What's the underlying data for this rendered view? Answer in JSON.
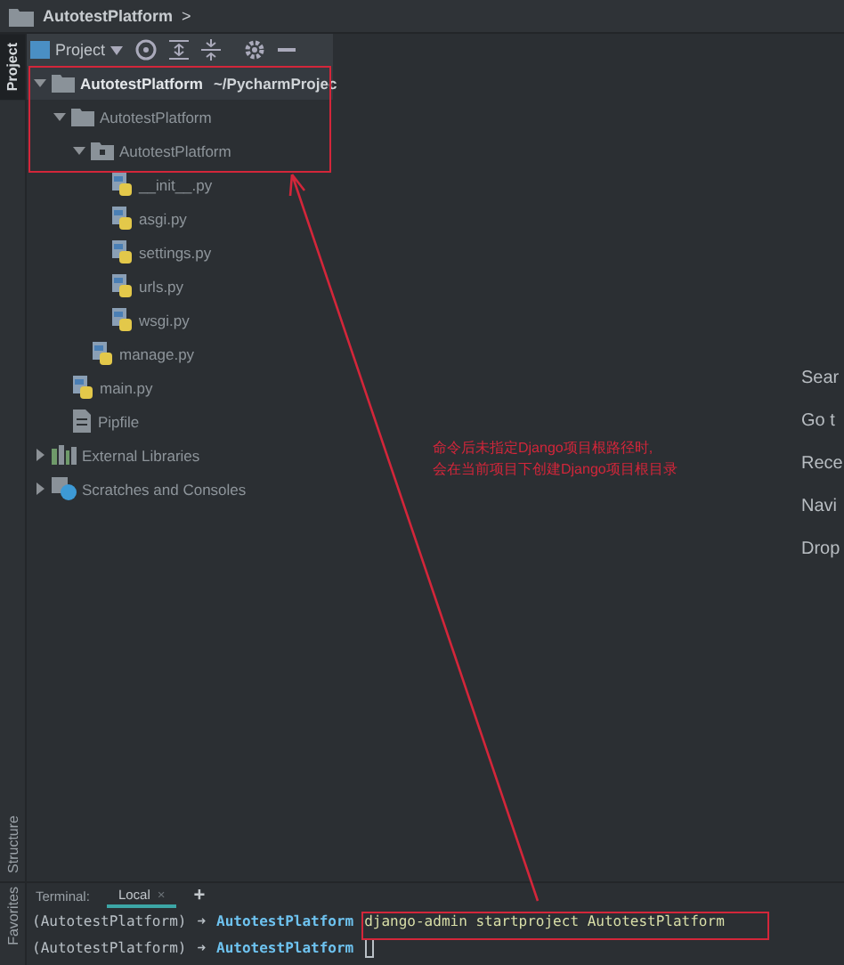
{
  "breadcrumb": {
    "label": "AutotestPlatform",
    "separator": ">"
  },
  "left_stripe": {
    "top": "Project",
    "bottom": [
      "Structure",
      "Favorites"
    ]
  },
  "project_panel": {
    "view": "Project",
    "tree": [
      {
        "label": "AutotestPlatform",
        "path": "~/PycharmProjec",
        "kind": "folder",
        "expanded": true,
        "selected": true,
        "children": [
          {
            "label": "AutotestPlatform",
            "kind": "folder",
            "expanded": true,
            "selected": false,
            "children": [
              {
                "label": "AutotestPlatform",
                "kind": "package",
                "expanded": true,
                "selected": false,
                "children": [
                  {
                    "label": "__init__.py",
                    "kind": "python",
                    "selected": false
                  },
                  {
                    "label": "asgi.py",
                    "kind": "python",
                    "selected": false
                  },
                  {
                    "label": "settings.py",
                    "kind": "python",
                    "selected": false
                  },
                  {
                    "label": "urls.py",
                    "kind": "python",
                    "selected": false
                  },
                  {
                    "label": "wsgi.py",
                    "kind": "python",
                    "selected": false
                  }
                ]
              },
              {
                "label": "manage.py",
                "kind": "python",
                "selected": false
              }
            ]
          },
          {
            "label": "main.py",
            "kind": "python",
            "selected": false
          },
          {
            "label": "Pipfile",
            "kind": "file",
            "selected": false
          }
        ]
      },
      {
        "label": "External Libraries",
        "kind": "libraries",
        "expanded": false,
        "selected": false
      },
      {
        "label": "Scratches and Consoles",
        "kind": "scratches",
        "expanded": false,
        "selected": false
      }
    ]
  },
  "editor_hints": [
    "Sear",
    "Go t",
    "Rece",
    "Navi",
    "Drop"
  ],
  "annotation": {
    "lines": [
      "命令后未指定Django项目根路径时,",
      "会在当前项目下创建Django项目根目录"
    ]
  },
  "terminal": {
    "title": "Terminal:",
    "tabs": [
      {
        "label": "Local",
        "selected": true,
        "close": "×"
      }
    ],
    "add": "+",
    "lines": [
      {
        "env": "(AutotestPlatform)",
        "arrow": "➜",
        "dir": "AutotestPlatform",
        "command": "django-admin startproject AutotestPlatform",
        "cursor": false
      },
      {
        "env": "(AutotestPlatform)",
        "arrow": "➜",
        "dir": "AutotestPlatform",
        "cursor": true
      }
    ]
  }
}
